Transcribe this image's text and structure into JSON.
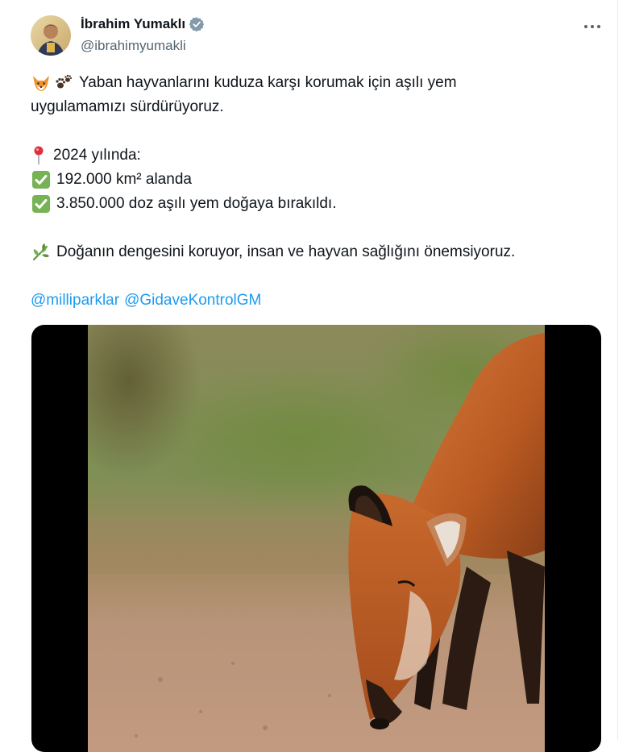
{
  "author": {
    "name": "İbrahim Yumaklı",
    "handle": "@ibrahimyumakli"
  },
  "icons": {
    "avatar": "user-avatar",
    "verified": "verified-badge-icon",
    "more": "more-options-icon",
    "fox": "fox-face-emoji",
    "paw": "paw-prints-emoji",
    "pin": "round-pushpin-emoji",
    "check": "check-mark-button-emoji",
    "herb": "herb-emoji"
  },
  "post": {
    "line1": "Yaban hayvanlarını kuduza karşı korumak için aşılı yem",
    "line2": "uygulamamızı sürdürüyoruz.",
    "line3": "2024 yılında:",
    "line4": "192.000 km² alanda",
    "line5": "3.850.000 doz aşılı yem doğaya bırakıldı.",
    "line6": "Doğanın dengesini koruyor, insan ve hayvan sağlığını önemsiyoruz.",
    "mention1": "@milliparklar",
    "mention2": "@GidaveKontrolGM"
  },
  "colors": {
    "link": "#1d9bf0",
    "verified": "#829aab",
    "secondary_text": "#536471"
  }
}
